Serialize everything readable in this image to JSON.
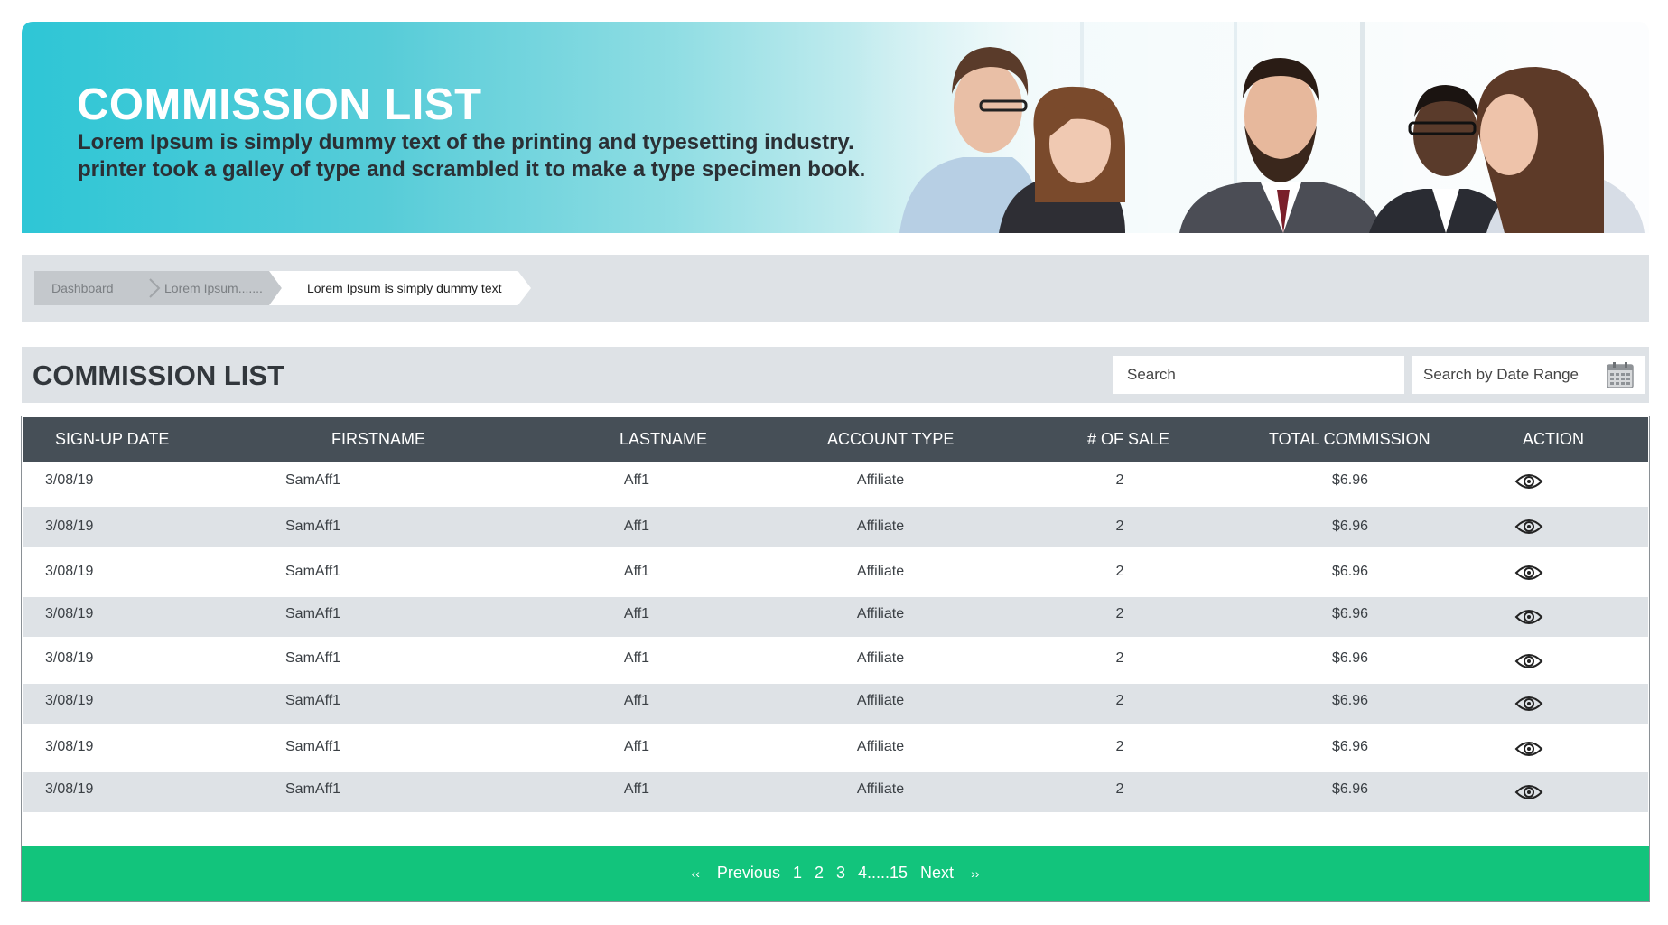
{
  "banner": {
    "title": "COMMISSION LIST",
    "subtitle_line1": "Lorem Ipsum is simply dummy text of the printing and typesetting industry.",
    "subtitle_line2": "printer took a galley of type and scrambled it to make a type specimen book."
  },
  "breadcrumb": {
    "items": [
      "Dashboard",
      "Lorem Ipsum.......",
      "Lorem Ipsum is simply dummy text"
    ]
  },
  "list": {
    "title": "COMMISSION LIST",
    "search_placeholder": "Search",
    "date_range_label": "Search by Date Range"
  },
  "table": {
    "columns": [
      "SIGN-UP DATE",
      "FIRSTNAME",
      "LASTNAME",
      "ACCOUNT TYPE",
      "# OF SALE",
      "TOTAL COMMISSION",
      "ACTION"
    ],
    "rows": [
      {
        "date": "3/08/19",
        "firstname": "SamAff1",
        "lastname": "Aff1",
        "account_type": "Affiliate",
        "sales": "2",
        "commission": "$6.96"
      },
      {
        "date": "3/08/19",
        "firstname": "SamAff1",
        "lastname": "Aff1",
        "account_type": "Affiliate",
        "sales": "2",
        "commission": "$6.96"
      },
      {
        "date": "3/08/19",
        "firstname": "SamAff1",
        "lastname": "Aff1",
        "account_type": "Affiliate",
        "sales": "2",
        "commission": "$6.96"
      },
      {
        "date": "3/08/19",
        "firstname": "SamAff1",
        "lastname": "Aff1",
        "account_type": "Affiliate",
        "sales": "2",
        "commission": "$6.96"
      },
      {
        "date": "3/08/19",
        "firstname": "SamAff1",
        "lastname": "Aff1",
        "account_type": "Affiliate",
        "sales": "2",
        "commission": "$6.96"
      },
      {
        "date": "3/08/19",
        "firstname": "SamAff1",
        "lastname": "Aff1",
        "account_type": "Affiliate",
        "sales": "2",
        "commission": "$6.96"
      },
      {
        "date": "3/08/19",
        "firstname": "SamAff1",
        "lastname": "Aff1",
        "account_type": "Affiliate",
        "sales": "2",
        "commission": "$6.96"
      },
      {
        "date": "3/08/19",
        "firstname": "SamAff1",
        "lastname": "Aff1",
        "account_type": "Affiliate",
        "sales": "2",
        "commission": "$6.96"
      }
    ],
    "action_icon": "eye-icon"
  },
  "pagination": {
    "first": "‹‹",
    "previous": "Previous",
    "pages": [
      "1",
      "2",
      "3",
      "4.....15"
    ],
    "next": "Next",
    "last": "››"
  },
  "colors": {
    "banner_accent": "#2ec6d6",
    "header_bg": "#464f57",
    "row_alt": "#dee2e6",
    "pager_bg": "#12c47c"
  }
}
